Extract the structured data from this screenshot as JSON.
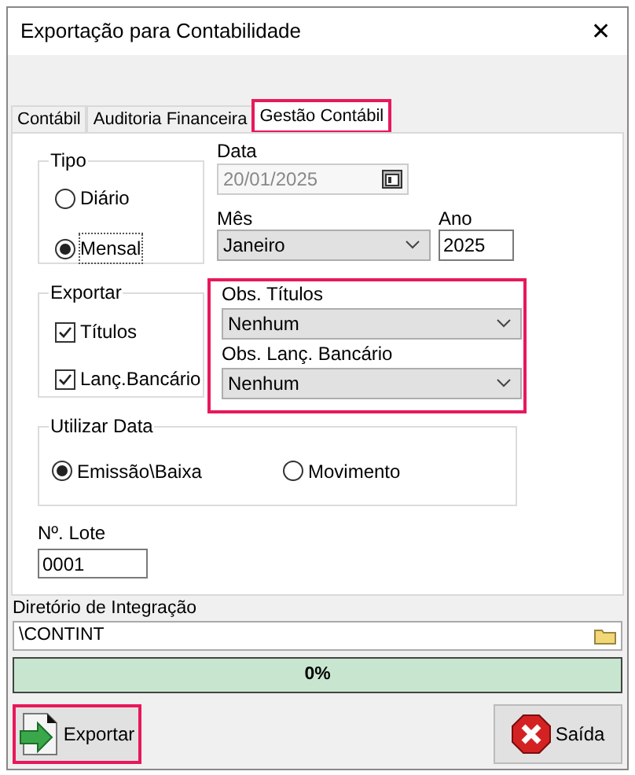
{
  "window": {
    "title": "Exportação para Contabilidade",
    "close": "✕"
  },
  "tabs": [
    {
      "label": "Contábil",
      "selected": false,
      "highlighted": false
    },
    {
      "label": "Auditoria Financeira",
      "selected": false,
      "highlighted": false
    },
    {
      "label": "Gestão Contábil",
      "selected": true,
      "highlighted": true
    }
  ],
  "tipo": {
    "title": "Tipo",
    "options": [
      {
        "label": "Diário",
        "selected": false
      },
      {
        "label": "Mensal",
        "selected": true
      }
    ]
  },
  "data": {
    "label": "Data",
    "value": "20/01/2025",
    "disabled": true
  },
  "mes": {
    "label": "Mês",
    "value": "Janeiro"
  },
  "ano": {
    "label": "Ano",
    "value": "2025"
  },
  "exportar": {
    "title": "Exportar",
    "items": [
      {
        "label": "Títulos",
        "checked": true
      },
      {
        "label": "Lanç.Bancário",
        "checked": true
      }
    ]
  },
  "obs": {
    "highlighted": true,
    "fields": [
      {
        "label": "Obs. Títulos",
        "value": "Nenhum"
      },
      {
        "label": "Obs. Lanç. Bancário",
        "value": "Nenhum"
      }
    ]
  },
  "utilizar_data": {
    "title": "Utilizar Data",
    "options": [
      {
        "label": "Emissão\\Baixa",
        "selected": true
      },
      {
        "label": "Movimento",
        "selected": false
      }
    ]
  },
  "lote": {
    "label": "Nº. Lote",
    "value": "0001"
  },
  "diretorio": {
    "label": "Diretório de Integração",
    "value": "\\CONTINT"
  },
  "progress": {
    "level": 0,
    "reading": "0%"
  },
  "buttons": [
    {
      "kind": "export",
      "label": "Exportar",
      "highlighted": true
    },
    {
      "kind": "exit",
      "label": "Saída",
      "highlighted": false
    }
  ]
}
